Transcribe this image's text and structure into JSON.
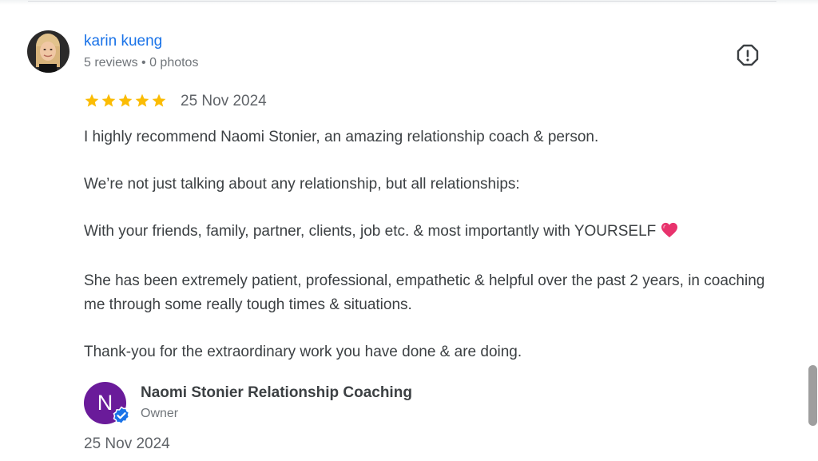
{
  "review": {
    "reviewer_name": "karin kueng",
    "reviewer_meta": "5 reviews • 0 photos",
    "rating": 5,
    "rating_max": 5,
    "date": "25 Nov 2024",
    "paragraphs": [
      "I highly recommend Naomi Stonier, an amazing relationship coach & person.",
      "We’re not just talking about any relationship, but all relationships:",
      "With your friends, family, partner, clients, job etc. & most importantly with YOURSELF",
      "She has been extremely patient, professional, empathetic & helpful over the past 2 years, in coaching me through some really tough times & situations.",
      "Thank-you for the extraordinary work you have done & are doing."
    ]
  },
  "owner_reply": {
    "avatar_letter": "N",
    "name": "Naomi Stonier Relationship Coaching",
    "role": "Owner",
    "date": "25 Nov 2024"
  },
  "icons": {
    "flag": "report-flag-icon",
    "star": "star-icon",
    "heart": "heart-icon",
    "verified": "verified-check-icon"
  },
  "colors": {
    "link_blue": "#1a73e8",
    "star_gold": "#fbbc04",
    "owner_avatar_purple": "#6a1b9a",
    "verified_blue": "#1a73e8",
    "heart_pink": "#e8336d"
  }
}
